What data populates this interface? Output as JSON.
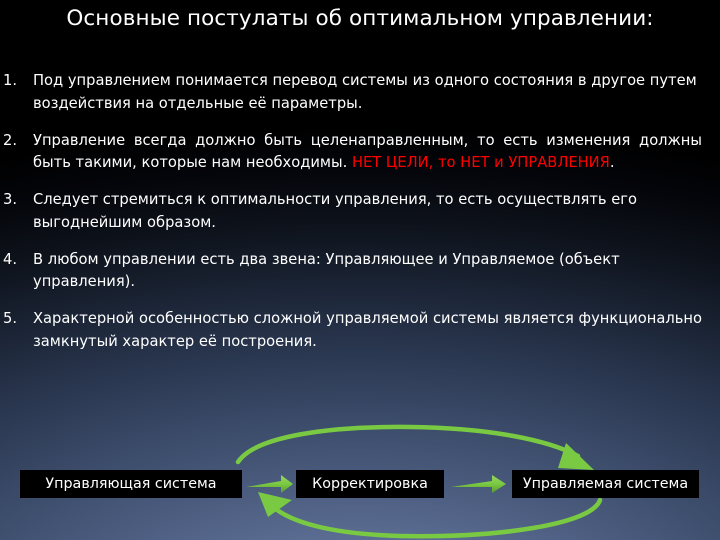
{
  "slide": {
    "title": "Основные постулаты об оптимальном управлении:",
    "colors": {
      "text": "#ffffff",
      "accent_red": "#ff0000",
      "arrow_green": "#7ac943",
      "box_fill": "#000000",
      "background_top": "#000000",
      "background_bottom": "#7e8fb4"
    }
  },
  "list": [
    {
      "number": "1.",
      "text": "Под управлением понимается перевод системы  из одного состояния в другое путем воздействия на отдельные её параметры."
    },
    {
      "number": "2.",
      "text_before": "Управление всегда должно быть целенаправленным, то есть изменения должны быть такими, которые нам необходимы. ",
      "text_highlight": "НЕТ ЦЕЛИ, то НЕТ и УПРАВЛЕНИЯ",
      "text_after": "."
    },
    {
      "number": "3.",
      "text": "Следует стремиться к  оптимальности управления, то есть осуществлять его выгоднейшим образом."
    },
    {
      "number": "4.",
      "text": "В любом управлении есть два звена: Управляющее и Управляемое (объект управления)."
    },
    {
      "number": "5.",
      "text": "Характерной особенностью сложной управляемой системы является функционально замкнутый характер её построения."
    }
  ],
  "diagram": {
    "nodes": [
      {
        "id": "control",
        "label": "Управляющая система"
      },
      {
        "id": "correction",
        "label": "Корректировка"
      },
      {
        "id": "managed",
        "label": "Управляемая система"
      }
    ],
    "connectors": [
      {
        "name": "control-to-correction",
        "type": "straight-arrow"
      },
      {
        "name": "correction-to-managed",
        "type": "straight-arrow"
      },
      {
        "name": "control-to-managed-feedforward",
        "type": "curved-arrow"
      },
      {
        "name": "managed-to-control-feedback",
        "type": "curved-arrow"
      }
    ]
  }
}
